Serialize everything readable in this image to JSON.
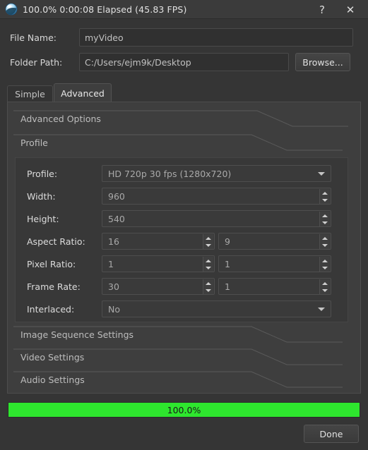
{
  "window": {
    "title": "100.0%  0:00:08 Elapsed (45.83 FPS)",
    "icon": "openshot-globe-icon",
    "help_label": "?",
    "close_label": "✕"
  },
  "form": {
    "file_name_label": "File Name:",
    "file_name_value": "myVideo",
    "file_name_placeholder": "myVideo",
    "folder_path_label": "Folder Path:",
    "folder_path_value": "C:/Users/ejm9k/Desktop",
    "folder_path_placeholder": "C:/Users/ejm9k/Desktop",
    "browse_label": "Browse..."
  },
  "tabs": [
    {
      "label": "Simple",
      "active": false
    },
    {
      "label": "Advanced",
      "active": true
    }
  ],
  "sections": {
    "advanced_options": "Advanced Options",
    "profile": "Profile",
    "image_sequence_settings": "Image Sequence Settings",
    "video_settings": "Video Settings",
    "audio_settings": "Audio Settings"
  },
  "profile_fields": {
    "profile": {
      "label": "Profile:",
      "value": "HD 720p 30 fps (1280x720)",
      "type": "combobox"
    },
    "width": {
      "label": "Width:",
      "value": "960",
      "type": "spinbox"
    },
    "height": {
      "label": "Height:",
      "value": "540",
      "type": "spinbox"
    },
    "aspect_ratio": {
      "label": "Aspect Ratio:",
      "value_num": "16",
      "value_den": "9",
      "type": "spinbox-pair"
    },
    "pixel_ratio": {
      "label": "Pixel Ratio:",
      "value_num": "1",
      "value_den": "1",
      "type": "spinbox-pair"
    },
    "frame_rate": {
      "label": "Frame Rate:",
      "value_num": "30",
      "value_den": "1",
      "type": "spinbox-pair"
    },
    "interlaced": {
      "label": "Interlaced:",
      "value": "No",
      "type": "combobox"
    }
  },
  "progress": {
    "label": "100.0%",
    "percent": 100,
    "color": "#2ee62e"
  },
  "footer": {
    "done_label": "Done"
  },
  "colors": {
    "window_bg": "#353535",
    "titlebar_bg": "#3b3b3b",
    "panel_bg": "#3e3e3e",
    "inner_panel_bg": "#383838",
    "field_bg": "#3a3a3a",
    "text": "#d6d6d6",
    "progress_green": "#2ee62e"
  }
}
